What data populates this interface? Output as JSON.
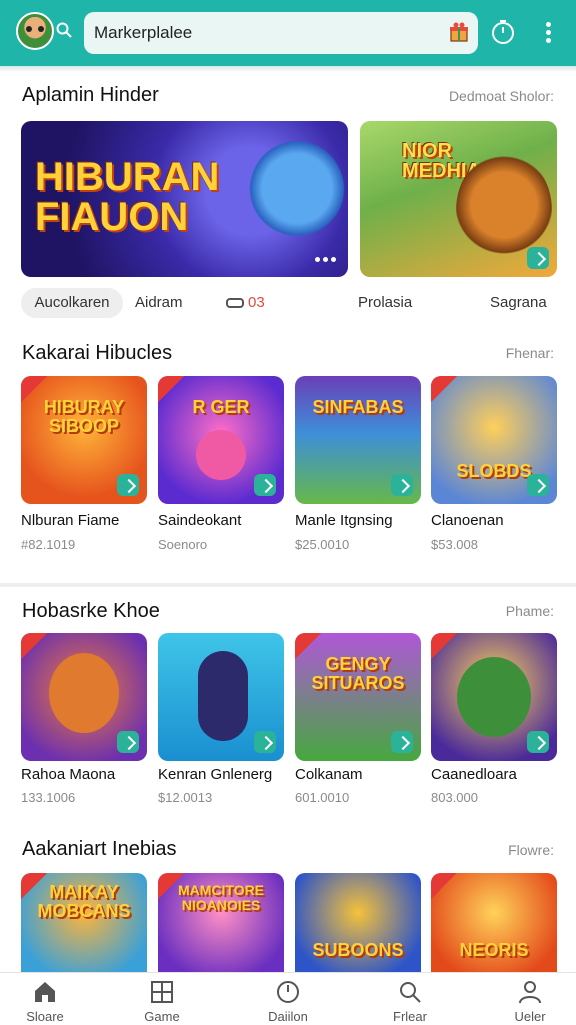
{
  "header": {
    "search_value": "Markerplalee",
    "icons": [
      "avatar",
      "search-icon",
      "gift-icon",
      "timer-icon",
      "more-icon"
    ],
    "accent": "#1fb5a9"
  },
  "featured": {
    "title": "Aplamin Hinder",
    "link": "Dedmoat Sholor:",
    "banners": [
      {
        "text": "HIBURAN FIAUON"
      },
      {
        "text": "NIOR MEDHIAS"
      }
    ]
  },
  "chips": [
    {
      "label": "Aucolkaren",
      "active": true
    },
    {
      "label": "Aidram"
    },
    {
      "label": "03",
      "icon": "toggle-icon"
    },
    {
      "label": "Prolasia"
    },
    {
      "label": "Sagrana"
    }
  ],
  "sections": [
    {
      "title": "Kakarai Hibucles",
      "link": "Fhenar:",
      "items": [
        {
          "art": "HIBURAY SIBOOP",
          "name": "Nlburan Fiame",
          "price": "#82.1019"
        },
        {
          "art": "R GER",
          "name": "Saindeokant",
          "price": "Soenoro"
        },
        {
          "art": "SINFABAS",
          "name": "Manle Itgnsing",
          "price": "$25.0010"
        },
        {
          "art": "SLOBDS",
          "name": "Clanoenan",
          "price": "$53.008"
        }
      ]
    },
    {
      "title": "Hobasrke Khoe",
      "link": "Phame:",
      "items": [
        {
          "art": "",
          "name": "Rahoa Maona",
          "price": "133.1006"
        },
        {
          "art": "",
          "name": "Kenran Gnlenerg",
          "price": "$12.0013"
        },
        {
          "art": "GENGY SITUAROS",
          "name": "Colkanam",
          "price": "601.0010"
        },
        {
          "art": "",
          "name": "Caanedloara",
          "price": "803.000"
        }
      ]
    },
    {
      "title": "Aakaniart Inebias",
      "link": "Flowre:",
      "items": [
        {
          "art": "MAIKAY MOBCANS"
        },
        {
          "art": "MAMCITORE NIOANOIES"
        },
        {
          "art": "SUBOONS"
        },
        {
          "art": "NEORIS"
        }
      ]
    }
  ],
  "nav": [
    {
      "label": "Sloare",
      "icon": "home-icon"
    },
    {
      "label": "Game",
      "icon": "grid-icon"
    },
    {
      "label": "Daiilon",
      "icon": "clock-icon"
    },
    {
      "label": "Frlear",
      "icon": "search-icon"
    },
    {
      "label": "Ueler",
      "icon": "user-icon"
    }
  ]
}
